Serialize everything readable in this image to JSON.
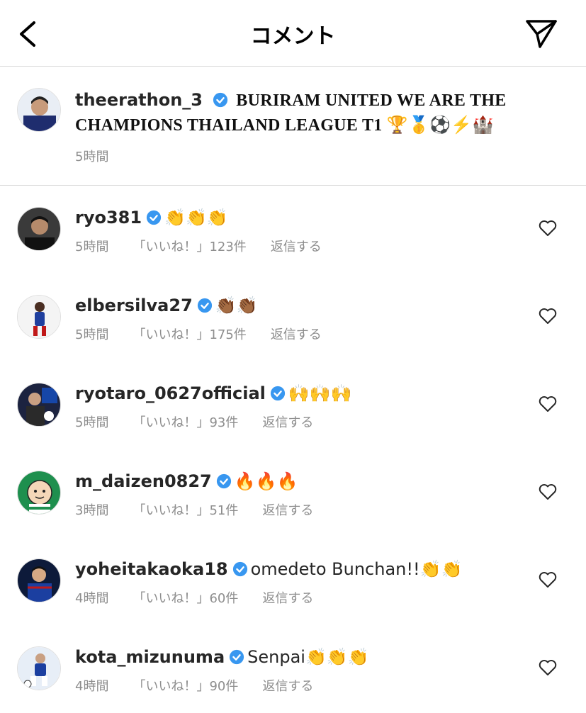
{
  "header": {
    "title": "コメント"
  },
  "post": {
    "username": "theerathon_3",
    "caption": "BURIRAM UNITED WE ARE THE CHAMPIONS THAILAND LEAGUE T1 🏆🥇⚽⚡🏰",
    "time": "5時間"
  },
  "comments": [
    {
      "username": "ryo381",
      "text": "👏👏👏",
      "time": "5時間",
      "likes": "「いいね！」123件",
      "reply": "返信する"
    },
    {
      "username": "elbersilva27",
      "text": "👏🏾👏🏾",
      "time": "5時間",
      "likes": "「いいね！」175件",
      "reply": "返信する"
    },
    {
      "username": "ryotaro_0627official",
      "text": "🙌🙌🙌",
      "time": "5時間",
      "likes": "「いいね！」93件",
      "reply": "返信する"
    },
    {
      "username": "m_daizen0827",
      "text": "🔥🔥🔥",
      "time": "3時間",
      "likes": "「いいね！」51件",
      "reply": "返信する"
    },
    {
      "username": "yoheitakaoka18",
      "text": "omedeto Bunchan!!👏👏",
      "time": "4時間",
      "likes": "「いいね！」60件",
      "reply": "返信する"
    },
    {
      "username": "kota_mizunuma",
      "text": "Senpai👏👏👏",
      "time": "4時間",
      "likes": "「いいね！」90件",
      "reply": "返信する"
    }
  ],
  "colors": {
    "verified": "#3897f0",
    "muted": "#8e8e8e",
    "divider": "#dbdbdb"
  }
}
